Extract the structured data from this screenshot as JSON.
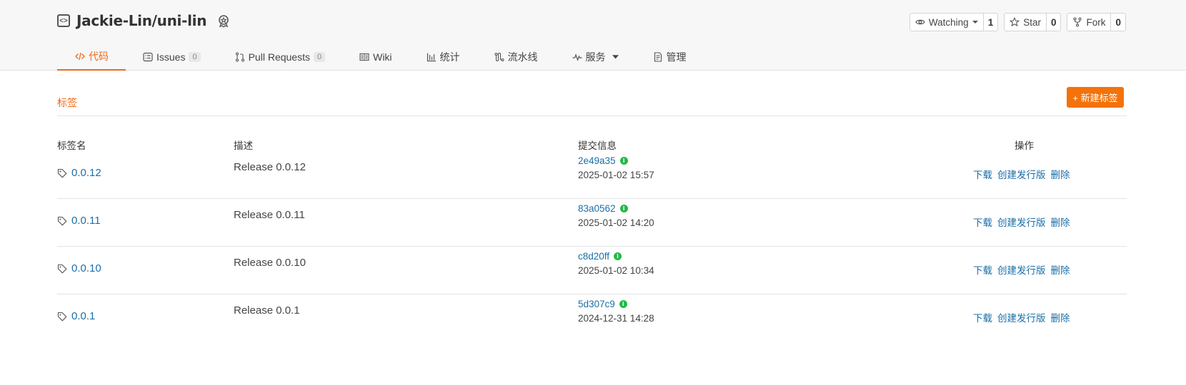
{
  "repo": {
    "name": "Jackie-Lin/uni-lin"
  },
  "actions": {
    "watch": {
      "label": "Watching",
      "count": "1"
    },
    "star": {
      "label": "Star",
      "count": "0"
    },
    "fork": {
      "label": "Fork",
      "count": "0"
    }
  },
  "tabs": [
    {
      "label": "代码"
    },
    {
      "label": "Issues",
      "count": "0"
    },
    {
      "label": "Pull Requests",
      "count": "0"
    },
    {
      "label": "Wiki"
    },
    {
      "label": "统计"
    },
    {
      "label": "流水线"
    },
    {
      "label": "服务"
    },
    {
      "label": "管理"
    }
  ],
  "section": {
    "title": "标签",
    "new_button": "+ 新建标签"
  },
  "columns": {
    "name": "标签名",
    "desc": "描述",
    "commit": "提交信息",
    "ops": "操作"
  },
  "tags": [
    {
      "name": "0.0.12",
      "desc": "Release 0.0.12",
      "hash": "2e49a35",
      "time": "2025-01-02 15:57"
    },
    {
      "name": "0.0.11",
      "desc": "Release 0.0.11",
      "hash": "83a0562",
      "time": "2025-01-02 14:20"
    },
    {
      "name": "0.0.10",
      "desc": "Release 0.0.10",
      "hash": "c8d20ff",
      "time": "2025-01-02 10:34"
    },
    {
      "name": "0.0.1",
      "desc": "Release 0.0.1",
      "hash": "5d307c9",
      "time": "2024-12-31 14:28"
    }
  ],
  "ops": {
    "download": "下载",
    "create_release": "创建发行版",
    "delete": "删除"
  },
  "colors": {
    "accent": "#f06a1b",
    "link": "#1b6fa8",
    "verified": "#21ba45"
  }
}
